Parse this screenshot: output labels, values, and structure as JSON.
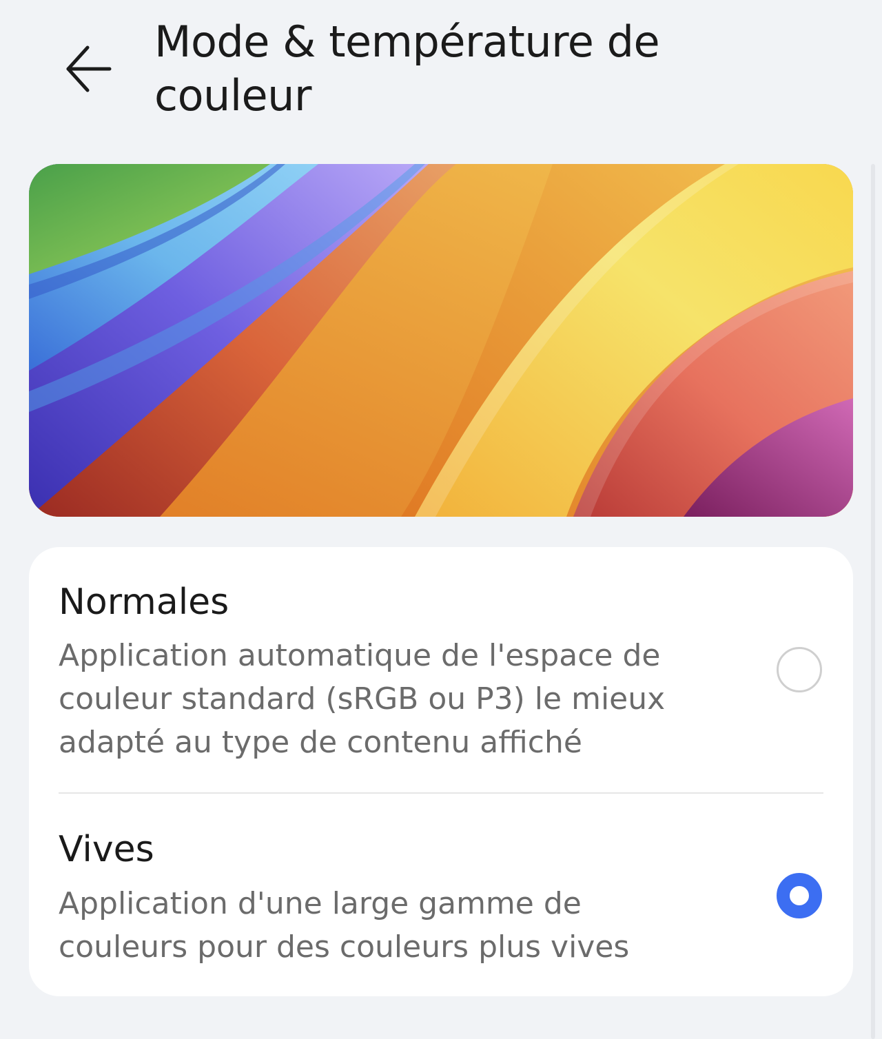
{
  "header": {
    "back_icon": "arrow-left-icon",
    "title_line1": "Mode & température de",
    "title_line2": "couleur"
  },
  "banner": {
    "description_icon": "rainbow-wallpaper-image",
    "colors": [
      "#62b34a",
      "#6bb6ec",
      "#6e5fe0",
      "#9b84f2",
      "#d9643a",
      "#f1a23a",
      "#f6e36a",
      "#e7725e",
      "#b6458f"
    ]
  },
  "options": [
    {
      "title": "Normales",
      "description_line1": "Application automatique de l'espace de",
      "description_line2": "couleur standard (sRGB ou P3) le mieux",
      "description_line3": "adapté au type de contenu affiché",
      "selected": false
    },
    {
      "title": "Vives",
      "description_line1": "Application d'une large gamme de",
      "description_line2": "couleurs pour des couleurs plus vives",
      "selected": true
    }
  ],
  "colors": {
    "background": "#f1f3f6",
    "card": "#ffffff",
    "accent": "#3c6ef2",
    "title_text": "#1a1a1a",
    "secondary_text": "#6b6b6b"
  }
}
